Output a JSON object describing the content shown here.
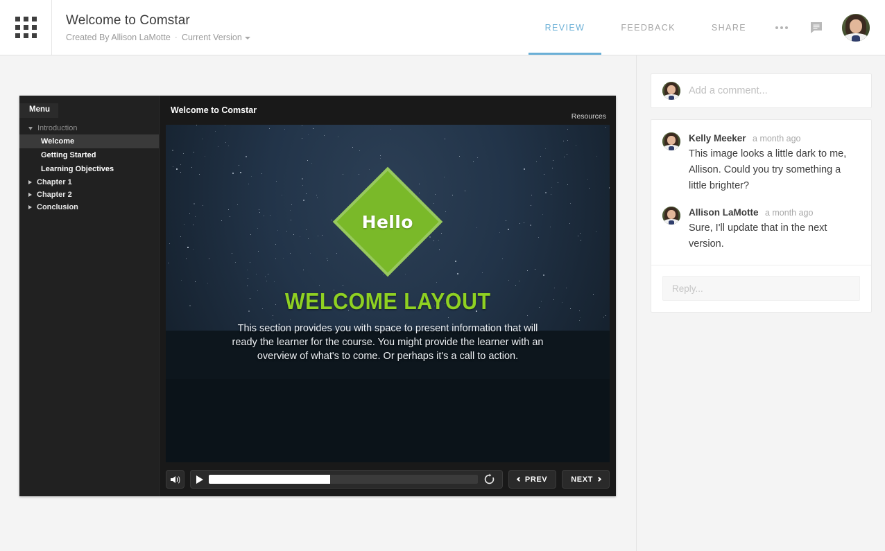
{
  "header": {
    "grid_icon": "apps-grid-icon",
    "title": "Welcome to Comstar",
    "created_by": "Created By Allison LaMotte",
    "separator": "·",
    "version_label": "Current Version",
    "nav_tabs": [
      {
        "label": "REVIEW",
        "active": true
      },
      {
        "label": "FEEDBACK",
        "active": false
      },
      {
        "label": "SHARE",
        "active": false
      }
    ],
    "more_icon": "ellipsis-icon",
    "comments_icon": "comment-bubble-icon",
    "avatar_icon": "user-avatar",
    "active_tab_color": "#6aafd6"
  },
  "player": {
    "menu_tab_label": "Menu",
    "menu": [
      {
        "label": "Introduction",
        "type": "group",
        "expanded": true
      },
      {
        "label": "Welcome",
        "type": "item",
        "selected": true
      },
      {
        "label": "Getting Started",
        "type": "item",
        "selected": false
      },
      {
        "label": "Learning Objectives",
        "type": "item",
        "selected": false
      },
      {
        "label": "Chapter 1",
        "type": "group",
        "expanded": false
      },
      {
        "label": "Chapter 2",
        "type": "group",
        "expanded": false
      },
      {
        "label": "Conclusion",
        "type": "group",
        "expanded": false
      }
    ],
    "slide_title": "Welcome to Comstar",
    "resources_label": "Resources",
    "slide": {
      "badge_text": "Hello",
      "heading": "WELCOME LAYOUT",
      "paragraph": "This section provides you with space to present information that will ready the learner for the course. You might provide the learner with an overview of what's to come. Or perhaps it's a call to action.",
      "badge_color": "#7ab929",
      "heading_color": "#8fd122",
      "background_color": "#1a2a3d"
    },
    "controls": {
      "volume_icon": "volume-icon",
      "play_icon": "play-icon",
      "replay_icon": "replay-icon",
      "seek_progress_percent": 45,
      "prev_label": "PREV",
      "next_label": "NEXT"
    }
  },
  "comments": {
    "add_placeholder": "Add a comment...",
    "items": [
      {
        "author": "Kelly Meeker",
        "time": "a month ago",
        "text": "This image looks a little dark to me, Allison. Could you try something a little brighter?"
      },
      {
        "author": "Allison LaMotte",
        "time": "a month ago",
        "text": "Sure, I'll update that in the next version."
      }
    ],
    "reply_placeholder": "Reply..."
  }
}
